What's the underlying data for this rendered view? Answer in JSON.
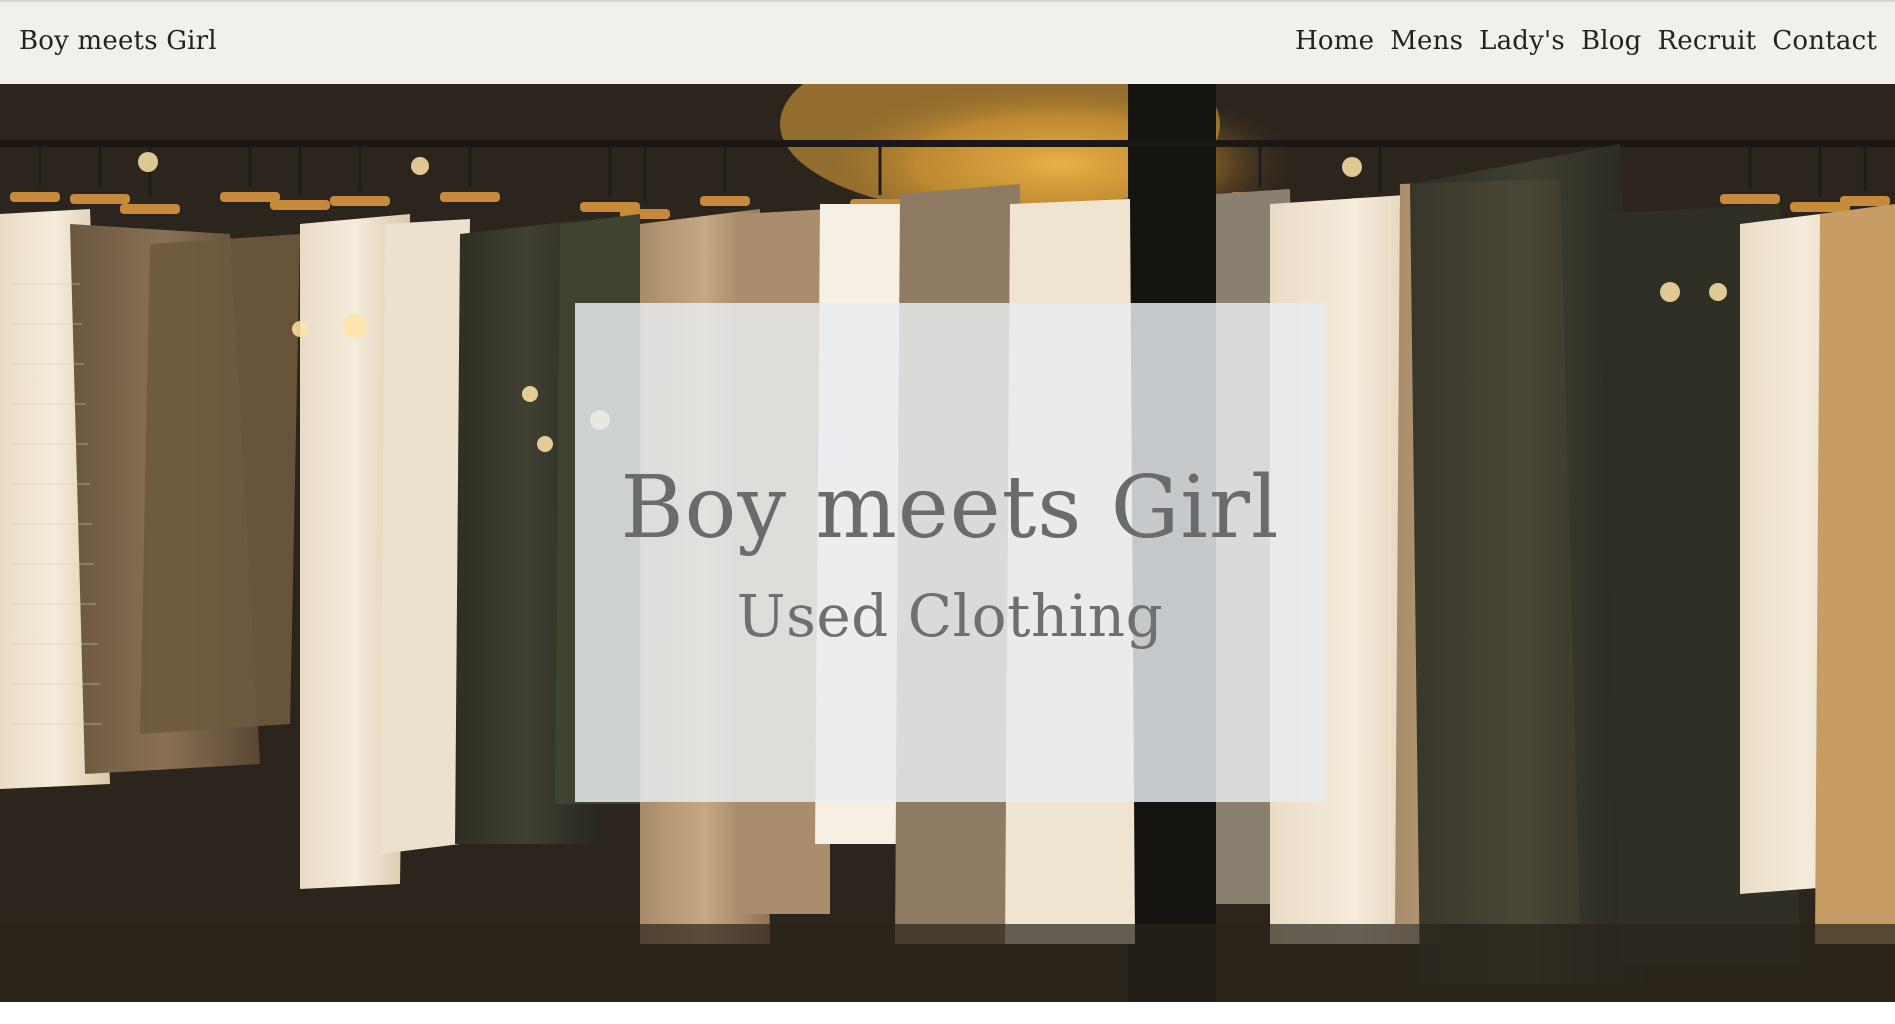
{
  "header": {
    "brand": "Boy meets Girl",
    "nav": [
      {
        "label": "Home"
      },
      {
        "label": "Mens"
      },
      {
        "label": "Lady's"
      },
      {
        "label": "Blog"
      },
      {
        "label": "Recruit"
      },
      {
        "label": "Contact"
      }
    ]
  },
  "hero": {
    "title": "Boy meets Girl",
    "subtitle": "Used Clothing"
  }
}
